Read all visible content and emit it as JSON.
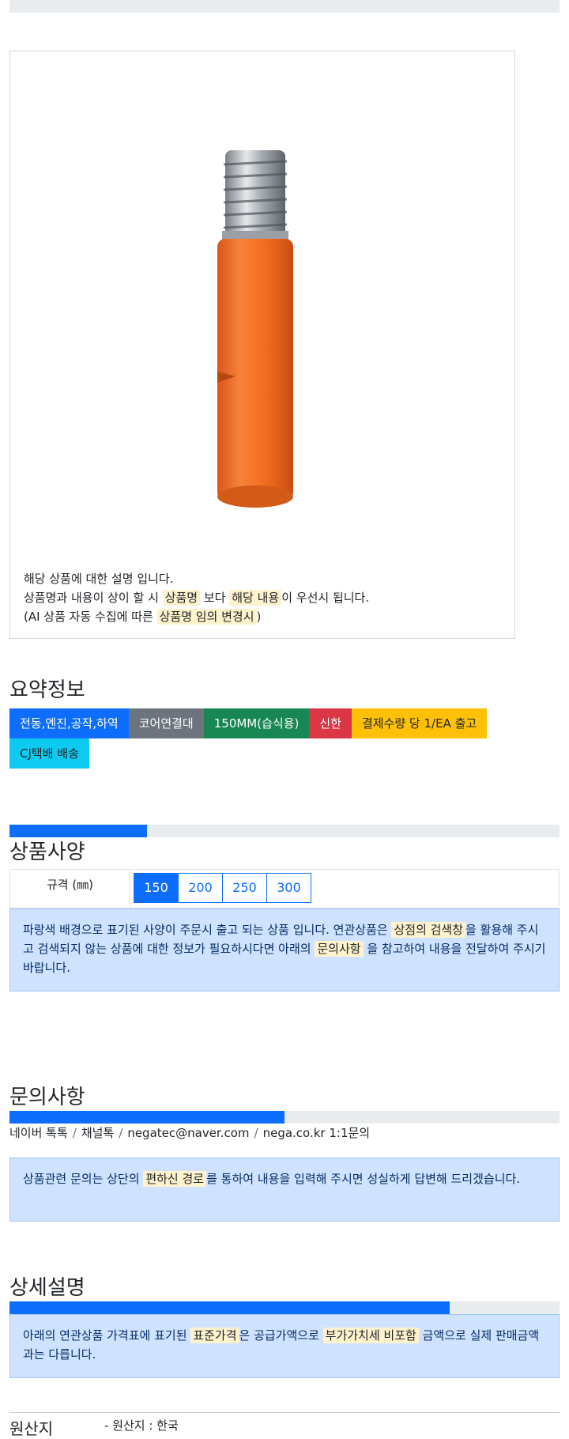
{
  "description": {
    "line1": "해당 상품에 대한 설명 입니다.",
    "line2_a": "상품명과 내용이 상이 할 시",
    "line2_hl1": "상품명",
    "line2_b": "보다",
    "line2_hl2": "해당 내용",
    "line2_c": "이 우선시 됩니다.",
    "line3_a": "(AI 상품 자동 수집에 따른",
    "line3_hl": "상품명 임의 변경시",
    "line3_b": ")"
  },
  "summary": {
    "title": "요약정보",
    "badges": [
      "전동,엔진,공작,하역",
      "코어연결대",
      "150MM(습식용)",
      "신한",
      "결제수량 당 1/EA 출고",
      "CJ택배 배송"
    ]
  },
  "spec": {
    "progress": 0.25,
    "title": "상품사양",
    "label": "규격 (㎜)",
    "options": [
      "150",
      "200",
      "250",
      "300"
    ],
    "selected": "150",
    "notice_a": "파랑색 배경으로 표기된 사양이 주문시 출고 되는 상품 입니다. 연관상품은",
    "notice_hl1": "상점의 검색창",
    "notice_b": "을 활용해 주시고 검색되지 않는 상품에 대한 정보가 필요하시다면 아래의",
    "notice_hl2": "문의사항",
    "notice_c": "을 참고하여 내용을 전달하여 주시기 바랍니다."
  },
  "inquiry": {
    "progress": 0.5,
    "title": "문의사항",
    "contacts": [
      "네이버 톡톡",
      "채널톡",
      "negatec@naver.com",
      "nega.co.kr 1:1문의"
    ],
    "notice_a": "상품관련 문의는 상단의",
    "notice_hl": "편하신 경로",
    "notice_b": "를 통하여 내용을 입력해 주시면 성실하게 답변해 드리겠습니다."
  },
  "detail": {
    "progress": 0.8,
    "title": "상세설명",
    "notice_a": "아래의 연관상품 가격표에 표기된",
    "notice_hl1": "표준가격",
    "notice_b": "은 공급가액으로",
    "notice_hl2": "부가가치세 비포함",
    "notice_c": "금액으로 실제 판매금액과는 다릅니다."
  },
  "origin": {
    "label": "원산지",
    "value": "- 원산지 : 한국"
  },
  "colors": {
    "primary": "#0d6efd",
    "product_orange": "#f26b1d",
    "highlight": "#fff3cd",
    "alert_bg": "#cfe2ff"
  }
}
